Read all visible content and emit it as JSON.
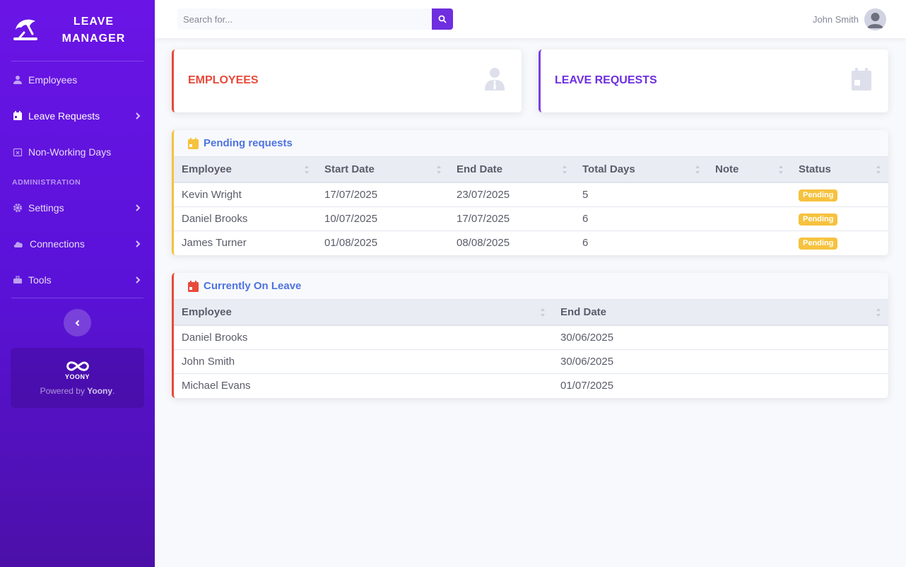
{
  "brand": {
    "line1": "LEAVE",
    "line2": "MANAGER",
    "icon": "beach-umbrella-icon"
  },
  "sidebar": {
    "items": [
      {
        "label": "Employees",
        "icon": "users-icon",
        "chevron": false
      },
      {
        "label": "Leave Requests",
        "icon": "calendar-icon",
        "chevron": true
      },
      {
        "label": "Non-Working Days",
        "icon": "calendar-x-icon",
        "chevron": false
      }
    ],
    "admin_heading": "ADMINISTRATION",
    "admin_items": [
      {
        "label": "Settings",
        "icon": "gear-icon",
        "chevron": true
      },
      {
        "label": "Connections",
        "icon": "cloud-icon",
        "chevron": true
      },
      {
        "label": "Tools",
        "icon": "toolbox-icon",
        "chevron": true
      }
    ],
    "promo": {
      "name": "YOONY",
      "powered_prefix": "Powered by ",
      "powered_brand": "Yoony",
      "powered_suffix": "."
    }
  },
  "topbar": {
    "search_placeholder": "Search for...",
    "user_name": "John Smith"
  },
  "cards": {
    "employees_title": "EMPLOYEES",
    "leave_requests_title": "LEAVE REQUESTS"
  },
  "pending": {
    "title": "Pending requests",
    "columns": [
      "Employee",
      "Start Date",
      "End Date",
      "Total Days",
      "Note",
      "Status"
    ],
    "rows": [
      {
        "employee": "Kevin Wright",
        "start": "17/07/2025",
        "end": "23/07/2025",
        "days": "5",
        "note": "",
        "status": "Pending"
      },
      {
        "employee": "Daniel Brooks",
        "start": "10/07/2025",
        "end": "17/07/2025",
        "days": "6",
        "note": "",
        "status": "Pending"
      },
      {
        "employee": "James Turner",
        "start": "01/08/2025",
        "end": "08/08/2025",
        "days": "6",
        "note": "",
        "status": "Pending"
      }
    ]
  },
  "on_leave": {
    "title": "Currently On Leave",
    "columns": [
      "Employee",
      "End Date"
    ],
    "rows": [
      {
        "employee": "Daniel Brooks",
        "end": "30/06/2025"
      },
      {
        "employee": "John Smith",
        "end": "30/06/2025"
      },
      {
        "employee": "Michael Evans",
        "end": "01/07/2025"
      }
    ]
  },
  "colors": {
    "primary": "#6f2ee0",
    "danger": "#e74a3b",
    "warning": "#f6c23e",
    "info": "#4e73df"
  }
}
